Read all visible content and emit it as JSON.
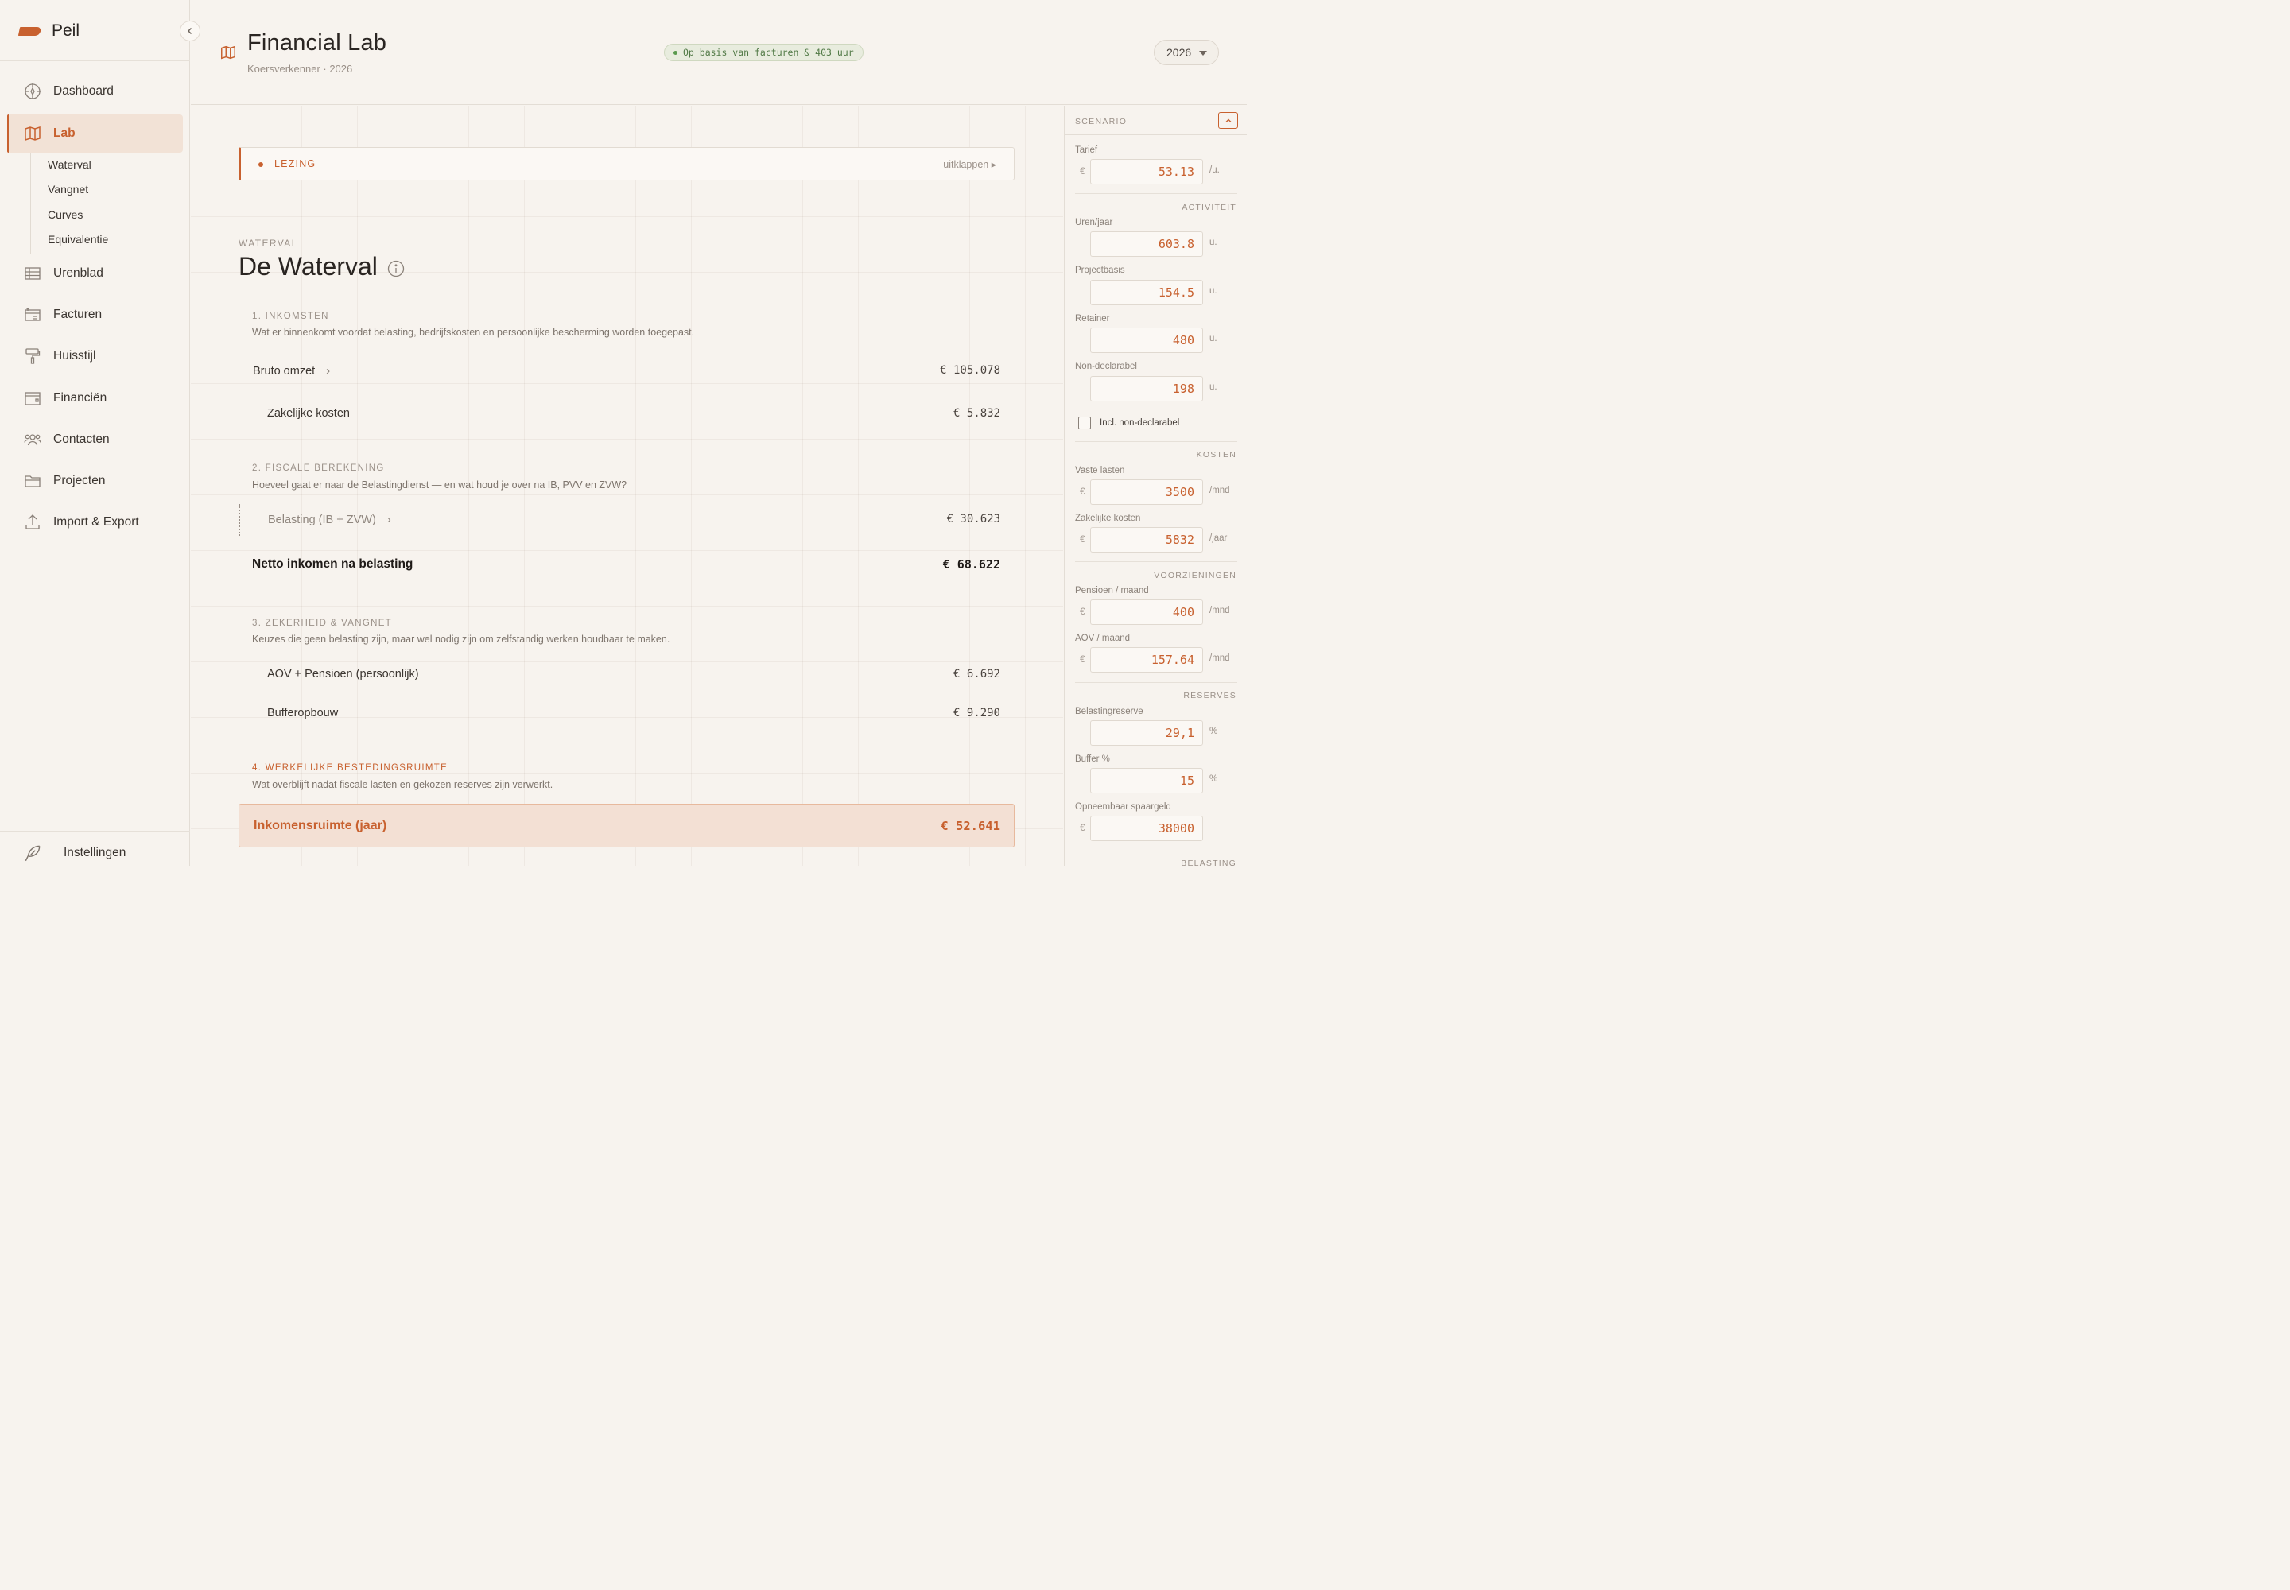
{
  "app": {
    "name": "Peil"
  },
  "nav": {
    "items": [
      {
        "key": "dashboard",
        "label": "Dashboard",
        "icon": "compass-icon"
      },
      {
        "key": "lab",
        "label": "Lab",
        "icon": "map-icon",
        "active": true
      },
      {
        "key": "urenblad",
        "label": "Urenblad",
        "icon": "table-icon"
      },
      {
        "key": "facturen",
        "label": "Facturen",
        "icon": "invoice-icon"
      },
      {
        "key": "huisstijl",
        "label": "Huisstijl",
        "icon": "paint-roller-icon"
      },
      {
        "key": "financien",
        "label": "Financiën",
        "icon": "wallet-icon"
      },
      {
        "key": "contacten",
        "label": "Contacten",
        "icon": "users-icon"
      },
      {
        "key": "projecten",
        "label": "Projecten",
        "icon": "folder-icon"
      },
      {
        "key": "import",
        "label": "Import & Export",
        "icon": "upload-icon"
      }
    ],
    "sub": [
      "Waterval",
      "Vangnet",
      "Curves",
      "Equivalentie"
    ],
    "settings": {
      "label": "Instellingen",
      "icon": "feather-icon"
    }
  },
  "header": {
    "title": "Financial Lab",
    "subtitle": "Koersverkenner · 2026",
    "basis": "Op basis van facturen & 403 uur",
    "year": "2026"
  },
  "lezing": {
    "label": "LEZING",
    "expand": "uitklappen ▸"
  },
  "waterfall": {
    "eyebrow": "WATERVAL",
    "title": "De Waterval",
    "groups": [
      {
        "label": "1. INKOMSTEN",
        "desc": "Wat er binnenkomt voordat belasting, bedrijfskosten en persoonlijke bescherming worden toegepast."
      },
      {
        "label": "2. FISCALE BEREKENING",
        "desc": "Hoeveel gaat er naar de Belastingdienst — en wat houd je over na IB, PVV en ZVW?"
      },
      {
        "label": "3. ZEKERHEID & VANGNET",
        "desc": "Keuzes die geen belasting zijn, maar wel nodig zijn om zelfstandig werken houdbaar te maken."
      },
      {
        "label": "4. WERKELIJKE BESTEDINGSRUIMTE",
        "desc": "Wat overblijft nadat fiscale lasten en gekozen reserves zijn verwerkt."
      }
    ],
    "rows": {
      "bruto": {
        "label": "Bruto omzet",
        "value": "€ 105.078"
      },
      "zakelijk": {
        "label": "Zakelijke kosten",
        "value": "€ 5.832"
      },
      "belasting": {
        "label": "Belasting (IB + ZVW)",
        "value": "€ 30.623"
      },
      "netto": {
        "label": "Netto inkomen na belasting",
        "value": "€ 68.622"
      },
      "aov": {
        "label": "AOV + Pensioen (persoonlijk)",
        "value": "€ 6.692"
      },
      "buffer": {
        "label": "Bufferopbouw",
        "value": "€ 9.290"
      }
    },
    "total": {
      "label": "Inkomensruimte (jaar)",
      "value": "€ 52.641"
    }
  },
  "scenario": {
    "title": "SCENARIO",
    "sections": {
      "activiteit": "ACTIVITEIT",
      "kosten": "KOSTEN",
      "voorzieningen": "VOORZIENINGEN",
      "reserves": "RESERVES",
      "belasting": "BELASTING"
    },
    "fields": {
      "tarief": {
        "label": "Tarief",
        "currency": "€",
        "value": "53.13",
        "unit": "/u."
      },
      "uren": {
        "label": "Uren/jaar",
        "currency": "",
        "value": "603.8",
        "unit": "u."
      },
      "projectbasis": {
        "label": "Projectbasis",
        "currency": "",
        "value": "154.5",
        "unit": "u."
      },
      "retainer": {
        "label": "Retainer",
        "currency": "",
        "value": "480",
        "unit": "u."
      },
      "nondecl": {
        "label": "Non-declarabel",
        "currency": "",
        "value": "198",
        "unit": "u."
      },
      "vastelasten": {
        "label": "Vaste lasten",
        "currency": "€",
        "value": "3500",
        "unit": "/mnd"
      },
      "zakelijkekosten": {
        "label": "Zakelijke kosten",
        "currency": "€",
        "value": "5832",
        "unit": "/jaar"
      },
      "pensioen": {
        "label": "Pensioen / maand",
        "currency": "€",
        "value": "400",
        "unit": "/mnd"
      },
      "aov": {
        "label": "AOV / maand",
        "currency": "€",
        "value": "157.64",
        "unit": "/mnd"
      },
      "belastingreserve": {
        "label": "Belastingreserve",
        "currency": "",
        "value": "29,1",
        "unit": "%"
      },
      "buffer": {
        "label": "Buffer %",
        "currency": "",
        "value": "15",
        "unit": "%"
      },
      "spaargeld": {
        "label": "Opneembaar spaargeld",
        "currency": "€",
        "value": "38000",
        "unit": ""
      }
    },
    "checkbox": {
      "label": "Incl. non-declarabel",
      "checked": false
    }
  }
}
